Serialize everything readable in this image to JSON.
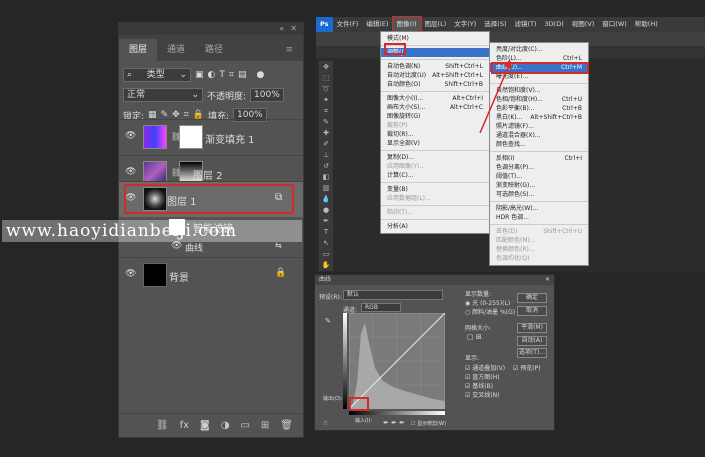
{
  "layers_panel": {
    "tabs": [
      "图层",
      "通道",
      "路径"
    ],
    "kind_label": "类型",
    "blend_mode": "正常",
    "opacity_label": "不透明度:",
    "opacity_value": "100%",
    "lock_label": "锁定:",
    "fill_label": "填充:",
    "fill_value": "100%",
    "layers": [
      {
        "name": "渐变填充 1"
      },
      {
        "name": "图层 2"
      },
      {
        "name": "图层 1"
      },
      {
        "name": "智能滤镜"
      },
      {
        "name": "曲线"
      },
      {
        "name": "背景"
      }
    ],
    "footer_icons": [
      "link-icon",
      "fx-icon",
      "mask-icon",
      "adjustment-icon",
      "folder-icon",
      "new-layer-icon",
      "trash-icon"
    ]
  },
  "watermark": "www.haoyidianbeiji.com",
  "ps_window": {
    "menubar": [
      "文件(F)",
      "编辑(E)",
      "图像(I)",
      "图层(L)",
      "文字(Y)",
      "选择(S)",
      "滤镜(T)",
      "3D(D)",
      "视图(V)",
      "窗口(W)",
      "帮助(H)"
    ],
    "image_menu": [
      {
        "label": "模式(M)",
        "shortcut": ""
      },
      {
        "sep": true
      },
      {
        "label": "调整(J)",
        "shortcut": "",
        "highlight": true
      },
      {
        "sep": true
      },
      {
        "label": "自动色调(N)",
        "shortcut": "Shift+Ctrl+L"
      },
      {
        "label": "自动对比度(U)",
        "shortcut": "Alt+Shift+Ctrl+L"
      },
      {
        "label": "自动颜色(O)",
        "shortcut": "Shift+Ctrl+B"
      },
      {
        "sep": true
      },
      {
        "label": "图像大小(I)...",
        "shortcut": "Alt+Ctrl+I"
      },
      {
        "label": "画布大小(S)...",
        "shortcut": "Alt+Ctrl+C"
      },
      {
        "label": "图像旋转(G)",
        "shortcut": ""
      },
      {
        "label": "裁剪(P)",
        "shortcut": "",
        "disabled": true
      },
      {
        "label": "裁切(R)...",
        "shortcut": ""
      },
      {
        "label": "显示全部(V)",
        "shortcut": ""
      },
      {
        "sep": true
      },
      {
        "label": "复制(D)...",
        "shortcut": ""
      },
      {
        "label": "应用图像(Y)...",
        "shortcut": "",
        "disabled": true
      },
      {
        "label": "计算(C)...",
        "shortcut": ""
      },
      {
        "sep": true
      },
      {
        "label": "变量(B)",
        "shortcut": ""
      },
      {
        "label": "应用数据组(L)...",
        "shortcut": "",
        "disabled": true
      },
      {
        "sep": true
      },
      {
        "label": "陷印(T)...",
        "shortcut": "",
        "disabled": true
      },
      {
        "sep": true
      },
      {
        "label": "分析(A)",
        "shortcut": ""
      }
    ],
    "adjust_menu": [
      {
        "label": "亮度/对比度(C)...",
        "shortcut": ""
      },
      {
        "label": "色阶(L)...",
        "shortcut": "Ctrl+L"
      },
      {
        "label": "曲线(U)...",
        "shortcut": "Ctrl+M",
        "highlight": true
      },
      {
        "label": "曝光度(E)...",
        "shortcut": ""
      },
      {
        "sep": true
      },
      {
        "label": "自然饱和度(V)...",
        "shortcut": ""
      },
      {
        "label": "色相/饱和度(H)...",
        "shortcut": "Ctrl+U"
      },
      {
        "label": "色彩平衡(B)...",
        "shortcut": "Ctrl+B"
      },
      {
        "label": "黑白(K)...",
        "shortcut": "Alt+Shift+Ctrl+B"
      },
      {
        "label": "照片滤镜(F)...",
        "shortcut": ""
      },
      {
        "label": "通道混合器(X)...",
        "shortcut": ""
      },
      {
        "label": "颜色查找...",
        "shortcut": ""
      },
      {
        "sep": true
      },
      {
        "label": "反相(I)",
        "shortcut": "Ctrl+I"
      },
      {
        "label": "色调分离(P)...",
        "shortcut": ""
      },
      {
        "label": "阈值(T)...",
        "shortcut": ""
      },
      {
        "label": "渐变映射(G)...",
        "shortcut": ""
      },
      {
        "label": "可选颜色(S)...",
        "shortcut": ""
      },
      {
        "sep": true
      },
      {
        "label": "阴影/高光(W)...",
        "shortcut": ""
      },
      {
        "label": "HDR 色调...",
        "shortcut": ""
      },
      {
        "sep": true
      },
      {
        "label": "去色(D)",
        "shortcut": "Shift+Ctrl+U",
        "disabled": true
      },
      {
        "label": "匹配颜色(M)...",
        "shortcut": "",
        "disabled": true
      },
      {
        "label": "替换颜色(R)...",
        "shortcut": "",
        "disabled": true
      },
      {
        "label": "色调均化(Q)",
        "shortcut": "",
        "disabled": true
      }
    ]
  },
  "curves_dialog": {
    "title": "曲线",
    "preset_label": "预设(R):",
    "preset_value": "默认",
    "channel_label": "通道:",
    "channel_value": "RGB",
    "ok_label": "确定",
    "cancel_label": "取消",
    "smooth_label": "平滑(M)",
    "auto_label": "自动(A)",
    "options_label": "选项(T)...",
    "preview_label": "预览(P)",
    "output_label": "输出(O):",
    "input_label": "输入(I):",
    "show_amount_label": "显示数量:",
    "light_label": "光 (0-255)(L)",
    "pigment_label": "颜料/油墨 %(G)",
    "grid_size_label": "网格大小:",
    "display_label": "显示:",
    "display_options": [
      "通道叠加(V)",
      "直方图(H)",
      "基线(B)",
      "交叉线(N)"
    ],
    "clipping_label": "显示修剪(W)"
  }
}
